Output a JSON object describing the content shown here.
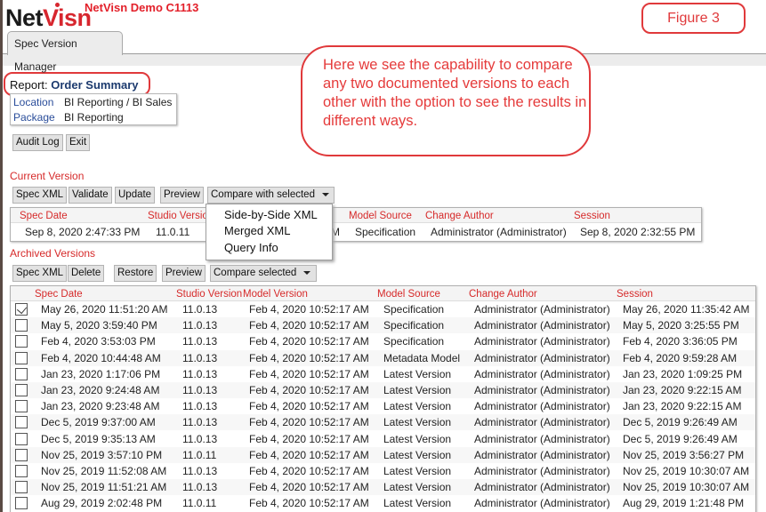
{
  "header": {
    "logo_net": "Net",
    "logo_visn": "Visn",
    "demo_title": "NetVisn Demo C1113",
    "figure_label": "Figure 3",
    "tab_label": "Spec Version Manager"
  },
  "annotation": {
    "text": "Here we see the capability to compare any two documented versions to each other with the option to see the results in different ways."
  },
  "report": {
    "prefix": "Report:",
    "name": "Order Summary",
    "location_label": "Location",
    "location_value": "BI Reporting / BI Sales",
    "package_label": "Package",
    "package_value": "BI Reporting"
  },
  "top_buttons": {
    "audit_log": "Audit Log",
    "exit": "Exit"
  },
  "current_version": {
    "section_label": "Current Version",
    "buttons": {
      "spec_xml": "Spec XML",
      "validate": "Validate",
      "update": "Update",
      "preview": "Preview",
      "compare": "Compare with selected"
    },
    "columns": [
      "Spec Date",
      "Studio Version",
      "Model Version",
      "Model Source",
      "Change Author",
      "Session"
    ],
    "row": {
      "spec_date": "Sep 8, 2020 2:47:33 PM",
      "studio_version": "11.0.11",
      "model_version_tail": "M",
      "model_source": "Specification",
      "change_author": "Administrator (Administrator)",
      "session": "Sep 8, 2020 2:32:55 PM"
    },
    "compare_menu": [
      "Side-by-Side XML",
      "Merged XML",
      "Query Info"
    ]
  },
  "archived_versions": {
    "section_label": "Archived Versions",
    "buttons": {
      "spec_xml": "Spec XML",
      "delete": "Delete",
      "restore": "Restore",
      "preview": "Preview",
      "compare": "Compare selected"
    },
    "columns": [
      "Spec Date",
      "Studio Version",
      "Model Version",
      "Model Source",
      "Change Author",
      "Session"
    ],
    "rows": [
      {
        "checked": true,
        "spec_date": "May 26, 2020 11:51:20 AM",
        "studio_version": "11.0.13",
        "model_version": "Feb 4, 2020 10:52:17 AM",
        "model_source": "Specification",
        "change_author": "Administrator (Administrator)",
        "session": "May 26, 2020 11:35:42 AM"
      },
      {
        "checked": false,
        "spec_date": "May 5, 2020 3:59:40 PM",
        "studio_version": "11.0.13",
        "model_version": "Feb 4, 2020 10:52:17 AM",
        "model_source": "Specification",
        "change_author": "Administrator (Administrator)",
        "session": "May 5, 2020 3:25:55 PM"
      },
      {
        "checked": false,
        "spec_date": "Feb 4, 2020 3:53:03 PM",
        "studio_version": "11.0.13",
        "model_version": "Feb 4, 2020 10:52:17 AM",
        "model_source": "Specification",
        "change_author": "Administrator (Administrator)",
        "session": "Feb 4, 2020 3:36:05 PM"
      },
      {
        "checked": false,
        "spec_date": "Feb 4, 2020 10:44:48 AM",
        "studio_version": "11.0.13",
        "model_version": "Feb 4, 2020 10:52:17 AM",
        "model_source": "Metadata Model",
        "change_author": "Administrator (Administrator)",
        "session": "Feb 4, 2020 9:59:28 AM"
      },
      {
        "checked": false,
        "spec_date": "Jan 23, 2020 1:17:06 PM",
        "studio_version": "11.0.13",
        "model_version": "Feb 4, 2020 10:52:17 AM",
        "model_source": "Latest Version",
        "change_author": "Administrator (Administrator)",
        "session": "Jan 23, 2020 1:09:25 PM"
      },
      {
        "checked": false,
        "spec_date": "Jan 23, 2020 9:24:48 AM",
        "studio_version": "11.0.13",
        "model_version": "Feb 4, 2020 10:52:17 AM",
        "model_source": "Latest Version",
        "change_author": "Administrator (Administrator)",
        "session": "Jan 23, 2020 9:22:15 AM"
      },
      {
        "checked": false,
        "spec_date": "Jan 23, 2020 9:23:48 AM",
        "studio_version": "11.0.13",
        "model_version": "Feb 4, 2020 10:52:17 AM",
        "model_source": "Latest Version",
        "change_author": "Administrator (Administrator)",
        "session": "Jan 23, 2020 9:22:15 AM"
      },
      {
        "checked": false,
        "spec_date": "Dec 5, 2019 9:37:00 AM",
        "studio_version": "11.0.13",
        "model_version": "Feb 4, 2020 10:52:17 AM",
        "model_source": "Latest Version",
        "change_author": "Administrator (Administrator)",
        "session": "Dec 5, 2019 9:26:49 AM"
      },
      {
        "checked": false,
        "spec_date": "Dec 5, 2019 9:35:13 AM",
        "studio_version": "11.0.13",
        "model_version": "Feb 4, 2020 10:52:17 AM",
        "model_source": "Latest Version",
        "change_author": "Administrator (Administrator)",
        "session": "Dec 5, 2019 9:26:49 AM"
      },
      {
        "checked": false,
        "spec_date": "Nov 25, 2019 3:57:10 PM",
        "studio_version": "11.0.11",
        "model_version": "Feb 4, 2020 10:52:17 AM",
        "model_source": "Latest Version",
        "change_author": "Administrator (Administrator)",
        "session": "Nov 25, 2019 3:56:27 PM"
      },
      {
        "checked": false,
        "spec_date": "Nov 25, 2019 11:52:08 AM",
        "studio_version": "11.0.13",
        "model_version": "Feb 4, 2020 10:52:17 AM",
        "model_source": "Latest Version",
        "change_author": "Administrator (Administrator)",
        "session": "Nov 25, 2019 10:30:07 AM"
      },
      {
        "checked": false,
        "spec_date": "Nov 25, 2019 11:51:21 AM",
        "studio_version": "11.0.13",
        "model_version": "Feb 4, 2020 10:52:17 AM",
        "model_source": "Latest Version",
        "change_author": "Administrator (Administrator)",
        "session": "Nov 25, 2019 10:30:07 AM"
      },
      {
        "checked": false,
        "spec_date": "Aug 29, 2019 2:02:48 PM",
        "studio_version": "11.0.11",
        "model_version": "Feb 4, 2020 10:52:17 AM",
        "model_source": "Latest Version",
        "change_author": "Administrator (Administrator)",
        "session": "Aug 29, 2019 1:21:48 PM"
      }
    ]
  }
}
